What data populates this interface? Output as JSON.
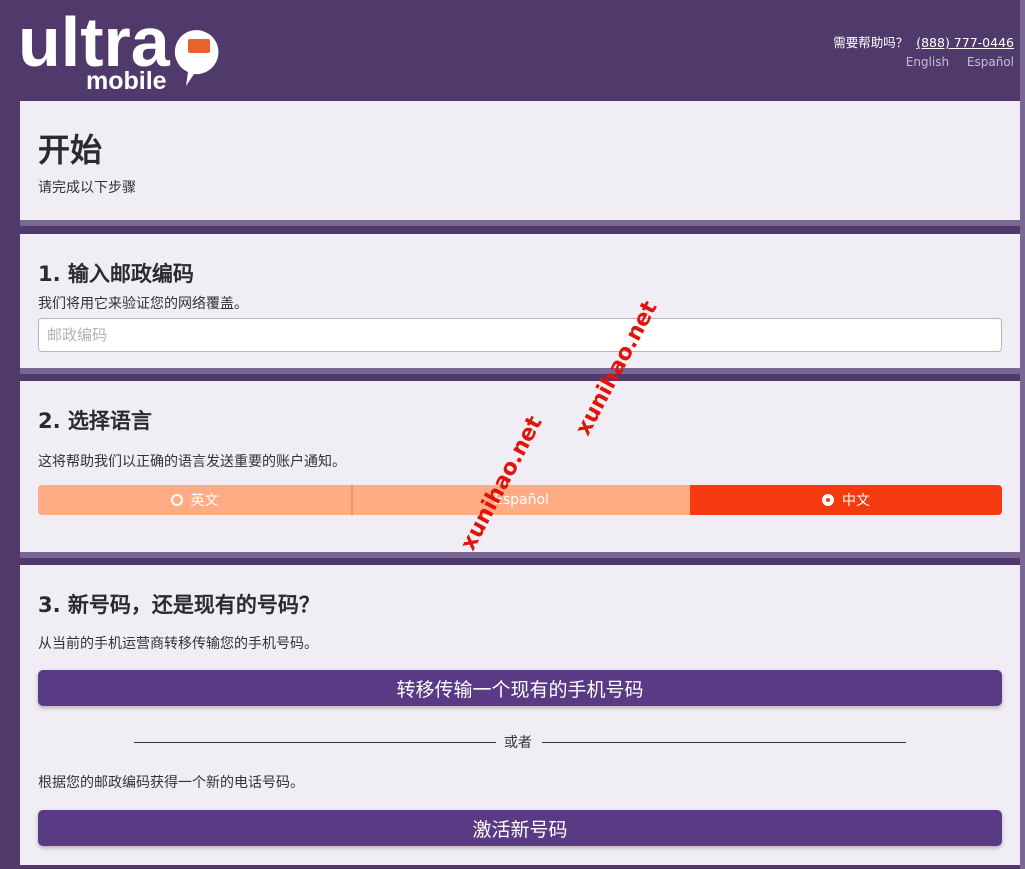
{
  "header": {
    "logo_word": "ultra",
    "logo_sub": "mobile",
    "help_label": "需要帮助吗？",
    "help_phone": "(888) 777-0446",
    "lang_english": "English",
    "lang_spanish": "Español"
  },
  "intro": {
    "title": "开始",
    "subtitle": "请完成以下步骤"
  },
  "step1": {
    "title": "1. 输入邮政编码",
    "desc": "我们将用它来验证您的网络覆盖。",
    "zip_placeholder": "邮政编码",
    "zip_value": ""
  },
  "step2": {
    "title": "2. 选择语言",
    "desc": "这将帮助我们以正确的语言发送重要的账户通知。",
    "options": [
      {
        "label": "英文",
        "selected": false
      },
      {
        "label": "Español",
        "selected": false
      },
      {
        "label": "中文",
        "selected": true
      }
    ]
  },
  "step3": {
    "title": "3. 新号码，还是现有的号码？",
    "transfer_desc": "从当前的手机运营商转移传输您的手机号码。",
    "transfer_button": "转移传输一个现有的手机号码",
    "or_label": "或者",
    "new_desc": "根据您的邮政编码获得一个新的电话号码。",
    "new_button": "激活新号码"
  },
  "watermarks": [
    "xunihao.net",
    "xunihao.net"
  ],
  "colors": {
    "background": "#4f3a6b",
    "card": "#f0edf5",
    "accent": "#f43a0e",
    "accent_light": "#ffac85",
    "button": "#5a3a85"
  },
  "icons": [
    "ultra-mobile-logo",
    "radio-unchecked-icon",
    "radio-checked-icon"
  ]
}
